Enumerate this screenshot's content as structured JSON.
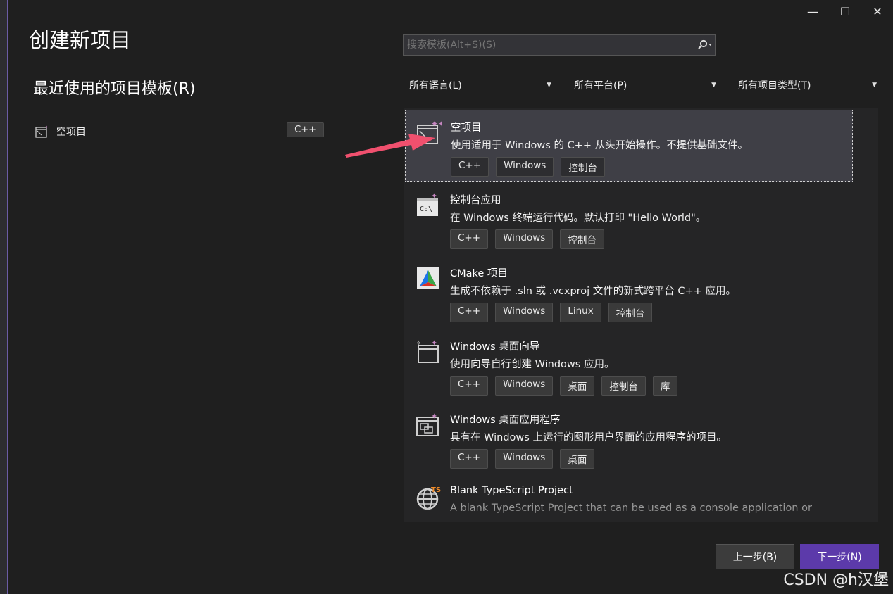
{
  "dialog": {
    "title": "创建新项目",
    "window_controls": {
      "minimize": "—",
      "maximize": "☐",
      "close": "✕"
    }
  },
  "recent": {
    "heading": "最近使用的项目模板(R)",
    "items": [
      {
        "label": "空项目",
        "tag": "C++"
      }
    ]
  },
  "search": {
    "placeholder": "搜索模板(Alt+S)(S)"
  },
  "filters": [
    {
      "label": "所有语言(L)"
    },
    {
      "label": "所有平台(P)"
    },
    {
      "label": "所有项目类型(T)"
    }
  ],
  "templates": [
    {
      "name": "空项目",
      "desc": "使用适用于 Windows 的 C++ 从头开始操作。不提供基础文件。",
      "tags": [
        "C++",
        "Windows",
        "控制台"
      ],
      "icon": "empty-project-icon",
      "selected": true
    },
    {
      "name": "控制台应用",
      "desc": "在 Windows 终端运行代码。默认打印 \"Hello World\"。",
      "tags": [
        "C++",
        "Windows",
        "控制台"
      ],
      "icon": "console-app-icon"
    },
    {
      "name": "CMake 项目",
      "desc": "生成不依赖于 .sln 或 .vcxproj 文件的新式跨平台 C++ 应用。",
      "tags": [
        "C++",
        "Windows",
        "Linux",
        "控制台"
      ],
      "icon": "cmake-icon"
    },
    {
      "name": "Windows 桌面向导",
      "desc": "使用向导自行创建 Windows 应用。",
      "tags": [
        "C++",
        "Windows",
        "桌面",
        "控制台",
        "库"
      ],
      "icon": "desktop-wizard-icon"
    },
    {
      "name": "Windows 桌面应用程序",
      "desc": "具有在 Windows 上运行的图形用户界面的应用程序的项目。",
      "tags": [
        "C++",
        "Windows",
        "桌面"
      ],
      "icon": "desktop-app-icon"
    },
    {
      "name": "Blank TypeScript Project",
      "desc": "A blank TypeScript Project that can be used as a console application or",
      "tags": [],
      "icon": "typescript-globe-icon"
    }
  ],
  "buttons": {
    "back": "上一步(B)",
    "next": "下一步(N)"
  },
  "watermark": "CSDN @h汉堡",
  "colors": {
    "accent": "#5c3aaa",
    "arrow": "#f0506e",
    "selected_bg": "#3f3f46"
  }
}
